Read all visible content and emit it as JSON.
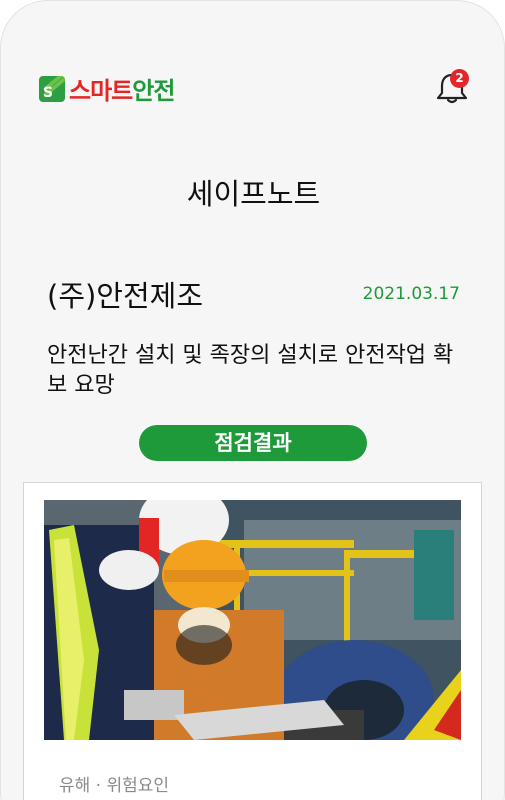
{
  "app": {
    "logo_text_red": "스마트",
    "logo_text_green": "안전",
    "logo_mark_letter": "S",
    "notification_count": "2"
  },
  "page": {
    "title": "세이프노트"
  },
  "note": {
    "company": "(주)안전제조",
    "date": "2021.03.17",
    "description": "안전난간 설치 및 족장의 설치로 안전작업 확보 요망",
    "result_button": "점검결과"
  },
  "card": {
    "category_label": "유해 · 위험요인"
  },
  "colors": {
    "brand_green": "#1e9a3a",
    "brand_red": "#e32624",
    "badge_red": "#e3262a"
  }
}
